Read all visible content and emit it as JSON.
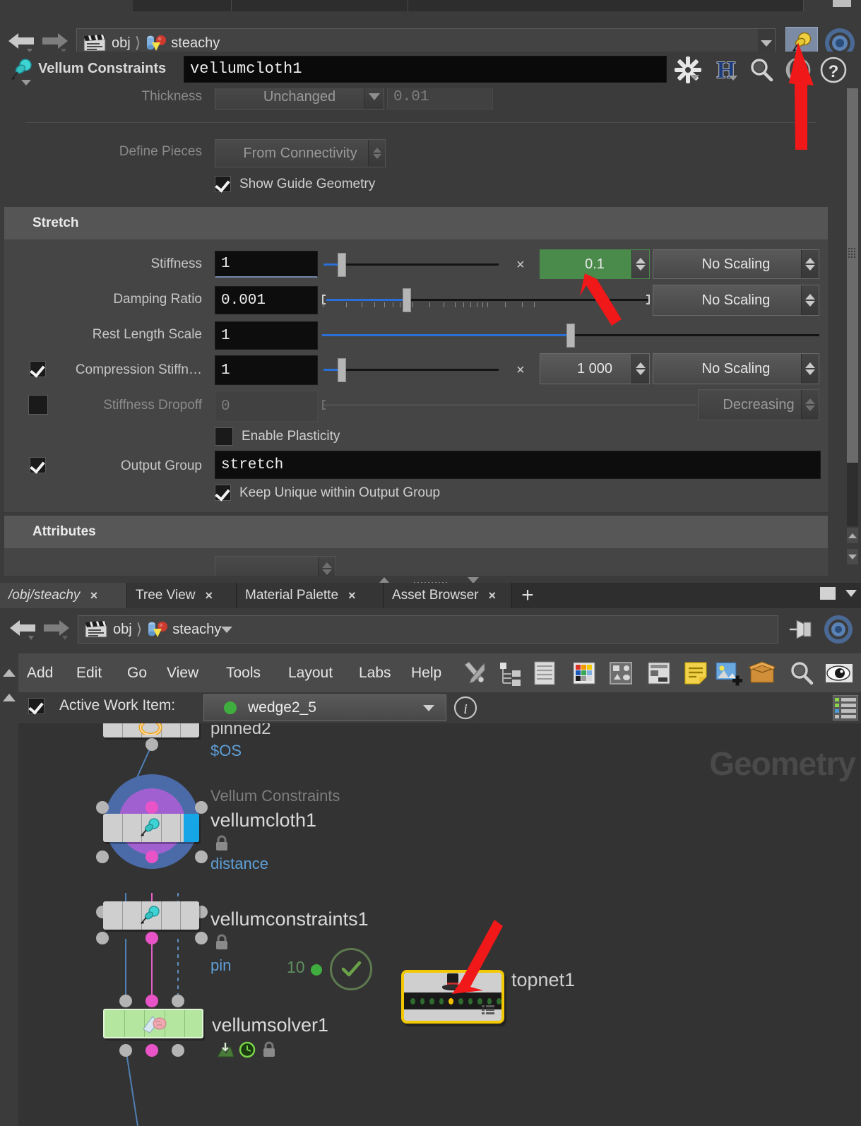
{
  "window": {
    "breadcrumb_top": {
      "root": "obj",
      "node": "steachy"
    },
    "breadcrumb_net": {
      "root": "obj",
      "node": "steachy"
    }
  },
  "parm_header": {
    "title": "Vellum Constraints",
    "node_name": "vellumcloth1",
    "icons": [
      "gear-icon",
      "houdini-h-icon",
      "search-icon",
      "moon-icon",
      "help-icon"
    ]
  },
  "parameters": {
    "thickness": {
      "label": "Thickness",
      "mode": "Unchanged",
      "value": "0.01"
    },
    "define_pieces": {
      "label": "Define Pieces",
      "value": "From Connectivity"
    },
    "show_guide_geometry": {
      "label": "Show Guide Geometry",
      "checked": true
    },
    "fold_stretch": "Stretch",
    "fold_attributes": "Attributes",
    "stiffness": {
      "label": "Stiffness",
      "value": "1",
      "mult_symbol": "×",
      "scale_value": "0.1",
      "scaling": "No Scaling"
    },
    "damping_ratio": {
      "label": "Damping Ratio",
      "value": "0.001",
      "scaling": "No Scaling"
    },
    "rest_length_scale": {
      "label": "Rest Length Scale",
      "value": "1"
    },
    "compression_stiffness": {
      "label": "Compression Stiffn…",
      "checked": true,
      "value": "1",
      "mult_symbol": "×",
      "scale_value": "1 000",
      "scaling": "No Scaling"
    },
    "stiffness_dropoff": {
      "label": "Stiffness Dropoff",
      "checked": false,
      "value": "0",
      "mode": "Decreasing"
    },
    "enable_plasticity": {
      "label": "Enable Plasticity",
      "checked": false
    },
    "output_group": {
      "label": "Output Group",
      "checked": true,
      "value": "stretch"
    },
    "keep_unique": {
      "label": "Keep Unique within Output Group",
      "checked": true
    }
  },
  "network_tabs": [
    {
      "label": "/obj/steachy",
      "active": true,
      "close": "×"
    },
    {
      "label": "Tree View",
      "active": false,
      "close": "×"
    },
    {
      "label": "Material Palette",
      "active": false,
      "close": "×"
    },
    {
      "label": "Asset Browser",
      "active": false,
      "close": "×"
    }
  ],
  "tab_add_label": "+",
  "menu": [
    "Add",
    "Edit",
    "Go",
    "View",
    "Tools",
    "Layout",
    "Labs",
    "Help"
  ],
  "menu_icons": [
    "wrench-screwdriver-icon",
    "node-tree-icon",
    "list-icon",
    "color-palette-icon",
    "shapes-icon",
    "layout-icon",
    "sticky-note-icon",
    "add-image-icon",
    "package-icon",
    "search-icon",
    "eye-icon"
  ],
  "work_item": {
    "label": "Active Work Item:",
    "checked": true,
    "value": "wedge2_5",
    "status_color": "#3fae3f",
    "info_icon": "info-icon",
    "list-icon": "table-icon"
  },
  "network": {
    "watermark": "Geometry",
    "nodes": [
      {
        "name": "pinned2",
        "expr": "$OS",
        "type": ""
      },
      {
        "name": "vellumcloth1",
        "type": "Vellum Constraints",
        "group": "distance",
        "locked": true
      },
      {
        "name": "vellumconstraints1",
        "type": "",
        "group": "pin",
        "locked": true
      },
      {
        "name": "vellumsolver1",
        "type": "",
        "group": "",
        "locked": true
      },
      {
        "name": "topnet1",
        "type": "",
        "group": ""
      }
    ],
    "badge_count": "10"
  },
  "colors": {
    "accent_green": "#4a8a4a",
    "arrow_red": "#f01818",
    "slider_blue": "#2a6fd6",
    "node_yellow": "#f2c800",
    "link_blue": "#5f9fd8"
  }
}
